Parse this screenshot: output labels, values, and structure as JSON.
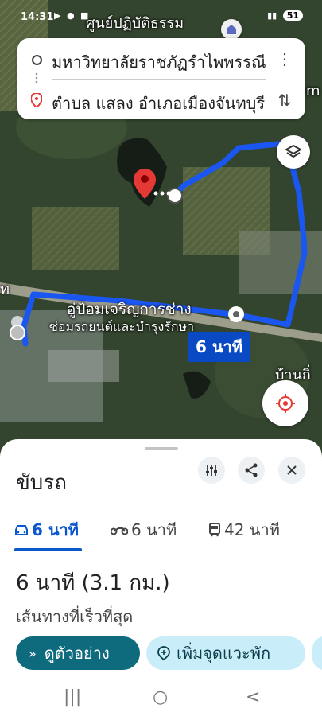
{
  "status_bar": {
    "time": "14:31",
    "battery": "51"
  },
  "map": {
    "labels": {
      "poi_top": "ศูนย์ปฏิบัติธรรม",
      "shop_name": "อู่ป้อมเจริญการช่าง",
      "shop_sub": "ซ่อมรถยนต์และบำรุงรักษา",
      "village": "บ้านกิ่",
      "edge_om": "m",
      "edge_th": "ท"
    },
    "route_time_tag": "6 นาที",
    "colors": {
      "route": "#1a56f0",
      "destination_pin": "#e53935"
    }
  },
  "route_card": {
    "origin": "มหาวิทยาลัยราชภัฏรำไพพรรณี",
    "destination": "ตำบล แสลง อำเภอเมืองจันทบุรี"
  },
  "icons": {
    "layers": "layers-icon",
    "locate": "my-location-icon",
    "more": "more-vert-icon",
    "swap": "swap-vert-icon"
  },
  "sheet": {
    "mode_title": "ขับรถ",
    "tabs": [
      {
        "label": "6 นาที",
        "icon": "car-icon"
      },
      {
        "label": "6 นาที",
        "icon": "motorcycle-icon"
      },
      {
        "label": "42 นาที",
        "icon": "transit-icon"
      }
    ],
    "summary_time": "6 นาที (3.1 กม.)",
    "summary_sub": "เส้นทางที่เร็วที่สุด",
    "preview_button": "ดูตัวอย่าง",
    "add_stop_button": "เพิ่มจุดแวะพัก"
  }
}
